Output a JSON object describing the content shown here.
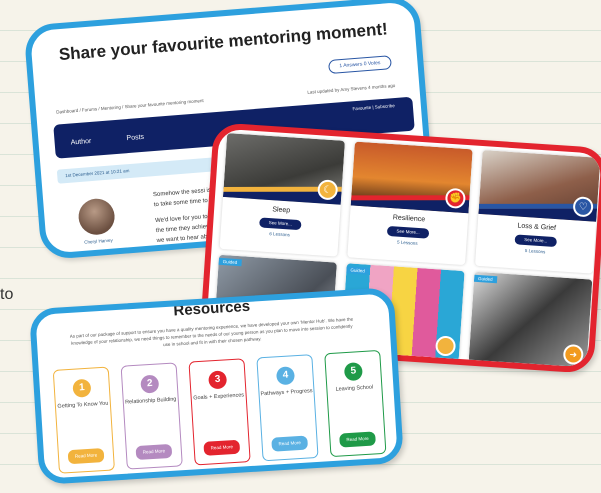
{
  "background": {
    "side_text": "to"
  },
  "forum_card": {
    "title": "Share your favourite mentoring moment!",
    "pill": "1 Answers 0 Votes",
    "breadcrumb": "Dashboard / Forums / Mentoring / Share your favourite mentoring moment",
    "updated": "Last updated by Amy Stevens 4 months ago",
    "header": {
      "author": "Author",
      "posts": "Posts",
      "actions": "Favourite | Subscribe"
    },
    "date": "1st December 2021 at 10:21 am",
    "avatar_name": "Cheryl Harvey",
    "post_lines": [
      "Somehow the sessi is coming to",
      "to take some time to reflect and",
      "",
      "We'd love for you to use this p",
      "the time they achieved a goal",
      "we want to hear about YOUR"
    ]
  },
  "courses_card": {
    "tiles": [
      {
        "title": "Sleep",
        "button": "See More...",
        "lessons": "6 Lessons",
        "badge_color": "#f2b33d",
        "badge_icon": "moon-icon"
      },
      {
        "title": "Resilience",
        "button": "See More...",
        "lessons": "5 Lessons",
        "badge_color": "#e3242e",
        "badge_icon": "muscle-icon"
      },
      {
        "title": "Loss & Grief",
        "button": "See More...",
        "lessons": "5 Lessons",
        "badge_color": "#2956a4",
        "badge_icon": "heart-icon"
      }
    ],
    "row2": [
      {
        "tag": "Guided"
      },
      {
        "tag": "Guided"
      },
      {
        "tag": "Guided"
      }
    ]
  },
  "resources_card": {
    "title": "Resources",
    "intro": "As part of our package of support to ensure you have a quality mentoring experience, we have developed your own ‘Mentor Hub’. We have the knowledge of your relationship, we need things to remember to the needs of our young person as you plan to move into session to confidently use in school and fit in with their chosen pathway.",
    "steps": [
      {
        "n": "1",
        "label": "Getting To Know You",
        "color": "#f2b33d",
        "button": "Read More"
      },
      {
        "n": "2",
        "label": "Relationship Building",
        "color": "#b48ac0",
        "button": "Read More"
      },
      {
        "n": "3",
        "label": "Goals + Experiences",
        "color": "#e3242e",
        "button": "Read More"
      },
      {
        "n": "4",
        "label": "Pathways + Progress",
        "color": "#5ab1e3",
        "button": "Read More"
      },
      {
        "n": "5",
        "label": "Leaving School",
        "color": "#1f9a48",
        "button": "Read More"
      }
    ]
  }
}
